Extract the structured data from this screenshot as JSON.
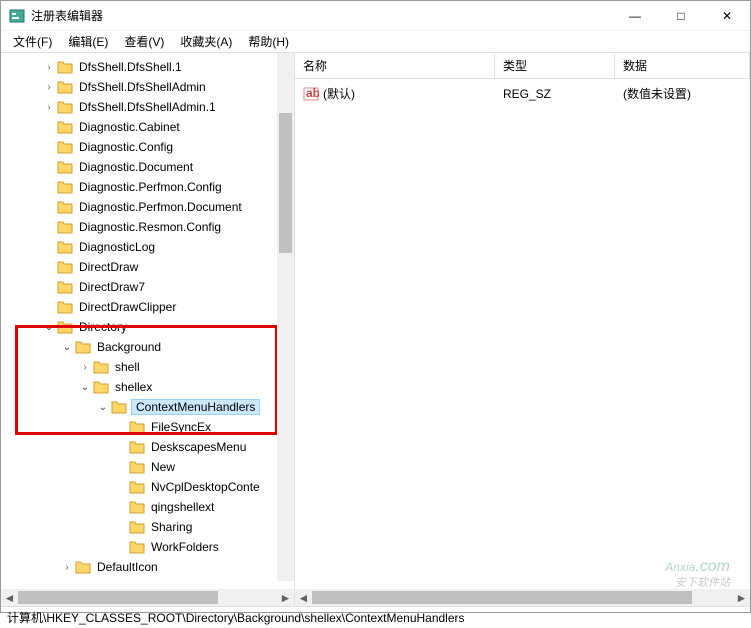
{
  "window": {
    "title": "注册表编辑器"
  },
  "titlebar_buttons": {
    "min": "—",
    "max": "□",
    "close": "✕"
  },
  "menu": [
    {
      "label": "文件(F)"
    },
    {
      "label": "编辑(E)"
    },
    {
      "label": "查看(V)"
    },
    {
      "label": "收藏夹(A)"
    },
    {
      "label": "帮助(H)"
    }
  ],
  "tree": [
    {
      "indent": 2,
      "chev": "›",
      "label": "DfsShell.DfsShell.1"
    },
    {
      "indent": 2,
      "chev": "›",
      "label": "DfsShell.DfsShellAdmin"
    },
    {
      "indent": 2,
      "chev": "›",
      "label": "DfsShell.DfsShellAdmin.1"
    },
    {
      "indent": 2,
      "chev": "",
      "label": "Diagnostic.Cabinet"
    },
    {
      "indent": 2,
      "chev": "",
      "label": "Diagnostic.Config"
    },
    {
      "indent": 2,
      "chev": "",
      "label": "Diagnostic.Document"
    },
    {
      "indent": 2,
      "chev": "",
      "label": "Diagnostic.Perfmon.Config"
    },
    {
      "indent": 2,
      "chev": "",
      "label": "Diagnostic.Perfmon.Document"
    },
    {
      "indent": 2,
      "chev": "",
      "label": "Diagnostic.Resmon.Config"
    },
    {
      "indent": 2,
      "chev": "",
      "label": "DiagnosticLog"
    },
    {
      "indent": 2,
      "chev": "",
      "label": "DirectDraw"
    },
    {
      "indent": 2,
      "chev": "",
      "label": "DirectDraw7"
    },
    {
      "indent": 2,
      "chev": "",
      "label": "DirectDrawClipper"
    },
    {
      "indent": 2,
      "chev": "⌄",
      "label": "Directory",
      "open": true
    },
    {
      "indent": 3,
      "chev": "⌄",
      "label": "Background",
      "open": true
    },
    {
      "indent": 4,
      "chev": "›",
      "label": "shell"
    },
    {
      "indent": 4,
      "chev": "⌄",
      "label": "shellex",
      "open": true
    },
    {
      "indent": 5,
      "chev": "⌄",
      "label": "ContextMenuHandlers",
      "open": true,
      "selected": true
    },
    {
      "indent": 6,
      "chev": "",
      "label": "FileSyncEx"
    },
    {
      "indent": 6,
      "chev": "",
      "label": "DeskscapesMenu"
    },
    {
      "indent": 6,
      "chev": "",
      "label": "New"
    },
    {
      "indent": 6,
      "chev": "",
      "label": "NvCplDesktopConte"
    },
    {
      "indent": 6,
      "chev": "",
      "label": "qingshellext"
    },
    {
      "indent": 6,
      "chev": "",
      "label": "Sharing"
    },
    {
      "indent": 6,
      "chev": "",
      "label": "WorkFolders"
    },
    {
      "indent": 3,
      "chev": "›",
      "label": "DefaultIcon"
    }
  ],
  "list": {
    "columns": {
      "name": "名称",
      "type": "类型",
      "data": "数据"
    },
    "rows": [
      {
        "name": "(默认)",
        "type": "REG_SZ",
        "data": "(数值未设置)"
      }
    ]
  },
  "statusbar": {
    "path": "计算机\\HKEY_CLASSES_ROOT\\Directory\\Background\\shellex\\ContextMenuHandlers"
  },
  "watermark": {
    "main": "Anxia",
    "suffix": ".com",
    "sub": "安下软件站"
  }
}
